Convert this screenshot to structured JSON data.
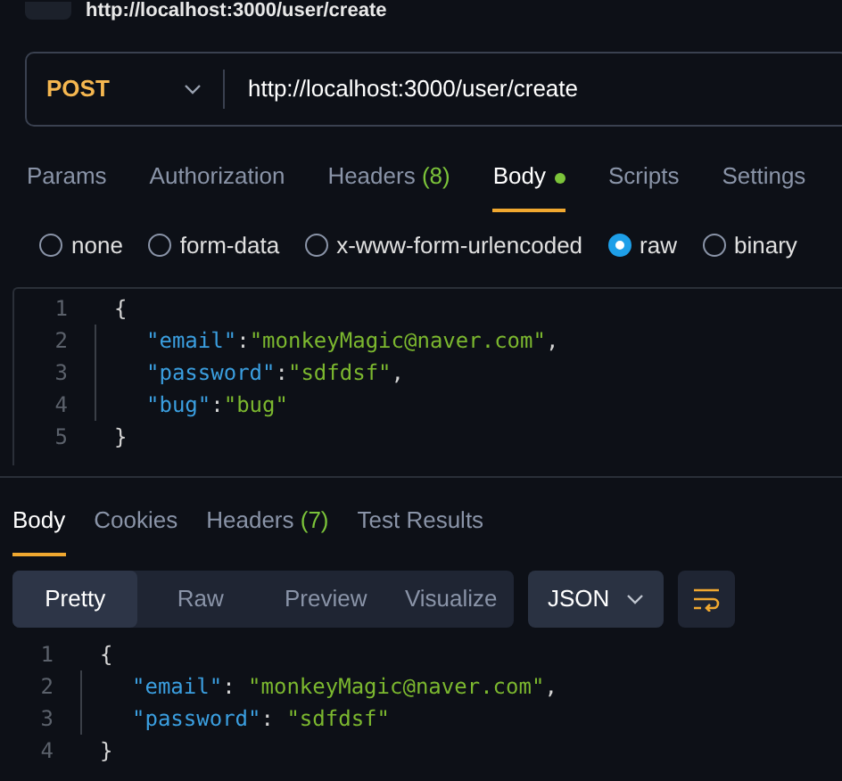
{
  "window": {
    "title": "http://localhost:3000/user/create"
  },
  "request": {
    "method": "POST",
    "url": "http://localhost:3000/user/create"
  },
  "tabs": [
    {
      "label": "Params",
      "selected": false
    },
    {
      "label": "Authorization",
      "selected": false
    },
    {
      "label": "Headers",
      "count": "(8)",
      "selected": false
    },
    {
      "label": "Body",
      "dot": true,
      "selected": true
    },
    {
      "label": "Scripts",
      "selected": false
    },
    {
      "label": "Settings",
      "selected": false
    }
  ],
  "body_types": [
    {
      "label": "none",
      "selected": false
    },
    {
      "label": "form-data",
      "selected": false
    },
    {
      "label": "x-www-form-urlencoded",
      "selected": false
    },
    {
      "label": "raw",
      "selected": true
    },
    {
      "label": "binary",
      "selected": false
    }
  ],
  "request_body": [
    {
      "number": "1",
      "indent": false,
      "tokens": [
        {
          "kind": "punct",
          "text": "{"
        }
      ]
    },
    {
      "number": "2",
      "indent": true,
      "tokens": [
        {
          "kind": "key",
          "text": "\"email\""
        },
        {
          "kind": "punct",
          "text": ":"
        },
        {
          "kind": "string",
          "text": "\"monkeyMagic@naver.com\""
        },
        {
          "kind": "punct",
          "text": ","
        }
      ]
    },
    {
      "number": "3",
      "indent": true,
      "tokens": [
        {
          "kind": "key",
          "text": "\"password\""
        },
        {
          "kind": "punct",
          "text": ":"
        },
        {
          "kind": "string",
          "text": "\"sdfdsf\""
        },
        {
          "kind": "punct",
          "text": ","
        }
      ]
    },
    {
      "number": "4",
      "indent": true,
      "tokens": [
        {
          "kind": "key",
          "text": "\"bug\""
        },
        {
          "kind": "punct",
          "text": ":"
        },
        {
          "kind": "string",
          "text": "\"bug\""
        }
      ]
    },
    {
      "number": "5",
      "indent": false,
      "tokens": [
        {
          "kind": "punct",
          "text": "}"
        }
      ]
    }
  ],
  "response_tabs": [
    {
      "label": "Body",
      "selected": true
    },
    {
      "label": "Cookies",
      "selected": false
    },
    {
      "label": "Headers",
      "count": "(7)",
      "selected": false
    },
    {
      "label": "Test Results",
      "selected": false
    }
  ],
  "view_modes": [
    {
      "label": "Pretty",
      "selected": true
    },
    {
      "label": "Raw",
      "selected": false
    },
    {
      "label": "Preview",
      "selected": false
    },
    {
      "label": "Visualize",
      "selected": false
    }
  ],
  "format": "JSON",
  "response_body": [
    {
      "number": "1",
      "indent": false,
      "tokens": [
        {
          "kind": "punct",
          "text": "{"
        }
      ]
    },
    {
      "number": "2",
      "indent": true,
      "tokens": [
        {
          "kind": "key",
          "text": "\"email\""
        },
        {
          "kind": "punct",
          "text": ": "
        },
        {
          "kind": "string",
          "text": "\"monkeyMagic@naver.com\""
        },
        {
          "kind": "punct",
          "text": ","
        }
      ]
    },
    {
      "number": "3",
      "indent": true,
      "tokens": [
        {
          "kind": "key",
          "text": "\"password\""
        },
        {
          "kind": "punct",
          "text": ": "
        },
        {
          "kind": "string",
          "text": "\"sdfdsf\""
        }
      ]
    },
    {
      "number": "4",
      "indent": false,
      "tokens": [
        {
          "kind": "punct",
          "text": "}"
        }
      ]
    }
  ]
}
